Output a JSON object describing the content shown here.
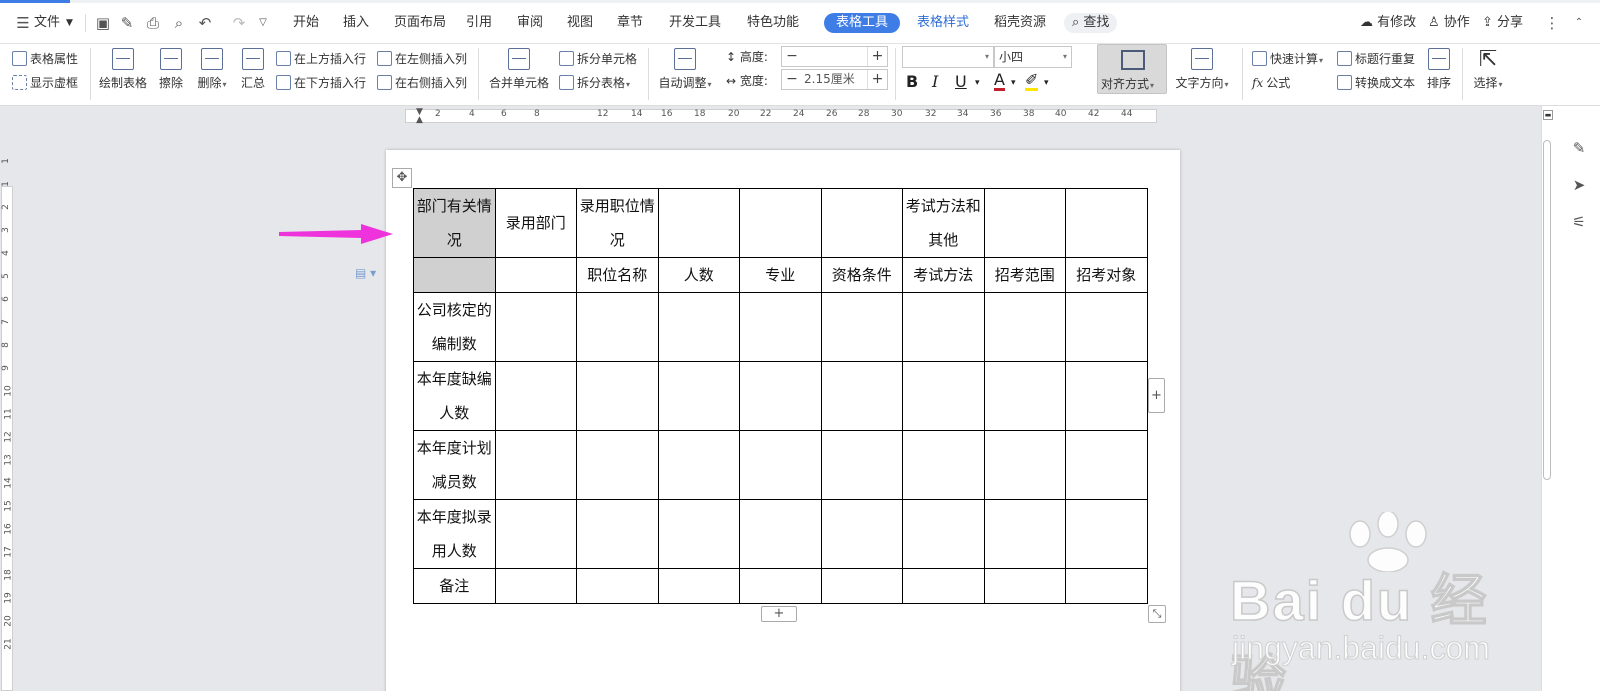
{
  "menu": {
    "file": "文件",
    "tabs": [
      "开始",
      "插入",
      "页面布局",
      "引用",
      "审阅",
      "视图",
      "章节",
      "开发工具",
      "特色功能"
    ],
    "active_tab": "表格工具",
    "tab_table_style": "表格样式",
    "tab_resources": "稻壳资源",
    "search": "查找",
    "modified": "有修改",
    "collab": "协作",
    "share": "分享"
  },
  "ribbon": {
    "table_props": "表格属性",
    "show_grid": "显示虚框",
    "draw_table": "绘制表格",
    "erase": "擦除",
    "delete": "删除",
    "summary": "汇总",
    "insert_above": "在上方插入行",
    "insert_below": "在下方插入行",
    "insert_left": "在左侧插入列",
    "insert_right": "在右侧插入列",
    "merge_cells": "合并单元格",
    "split_cells": "拆分单元格",
    "split_table": "拆分表格",
    "auto_fit": "自动调整",
    "height_label": "高度:",
    "width_label": "宽度:",
    "width_value": "2.15厘米",
    "font_size": "小四",
    "align": "对齐方式",
    "text_direction": "文字方向",
    "quick_calc": "快速计算",
    "repeat_title": "标题行重复",
    "formula": "公式",
    "to_text": "转换成文本",
    "sort": "排序",
    "select": "选择"
  },
  "ruler_numbers": [
    "2",
    "4",
    "6",
    "8",
    "12",
    "14",
    "16",
    "18",
    "20",
    "22",
    "24",
    "26",
    "28",
    "30",
    "32",
    "34",
    "36",
    "38",
    "40",
    "42",
    "44"
  ],
  "vruler_numbers": [
    "1",
    "1",
    "2",
    "3",
    "4",
    "5",
    "6",
    "7",
    "8",
    "9",
    "10",
    "11",
    "12",
    "13",
    "14",
    "15",
    "16",
    "17",
    "18",
    "19",
    "20",
    "21"
  ],
  "table": {
    "header_rows": [
      [
        "部门有关情况",
        "录用部门",
        "录用职位情况",
        "",
        "",
        "",
        "考试方法和其他",
        "",
        ""
      ],
      [
        "",
        "",
        "职位名称",
        "人数",
        "专业",
        "资格条件",
        "考试方法",
        "招考范围",
        "招考对象"
      ]
    ],
    "body_rows": [
      [
        "公司核定的编制数",
        "",
        "",
        "",
        "",
        "",
        "",
        "",
        ""
      ],
      [
        "本年度缺编人数",
        "",
        "",
        "",
        "",
        "",
        "",
        "",
        ""
      ],
      [
        "本年度计划减员数",
        "",
        "",
        "",
        "",
        "",
        "",
        "",
        ""
      ],
      [
        "本年度拟录用人数",
        "",
        "",
        "",
        "",
        "",
        "",
        "",
        ""
      ],
      [
        "备注",
        "",
        "",
        "",
        "",
        "",
        "",
        "",
        ""
      ]
    ]
  },
  "watermark": {
    "brand": "Bai du 经验",
    "url": "jingyan.baidu.com"
  },
  "colors": {
    "accent": "#3f7de6",
    "arrow": "#ee33dd",
    "cell_highlight": "#d0d0d0"
  }
}
